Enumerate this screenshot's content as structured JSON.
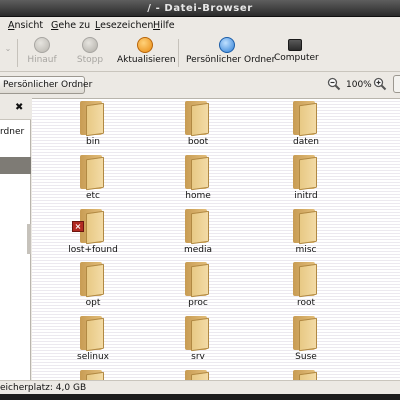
{
  "window": {
    "title": "/ - Datei-Browser"
  },
  "menubar": [
    "Ansicht",
    "Gehe zu",
    "Lesezeichen",
    "Hilfe"
  ],
  "toolbar": {
    "back_label": "",
    "up_label": "Hinauf",
    "stop_label": "Stopp",
    "reload_label": "Aktualisieren",
    "home_label": "Persönlicher Ordner",
    "computer_label": "Computer"
  },
  "location": {
    "button_label": "Persönlicher Ordner",
    "zoom": "100%"
  },
  "sidebar": {
    "close_glyph": "✖",
    "item_partial": "rdner"
  },
  "folders": [
    {
      "name": "bin"
    },
    {
      "name": "boot"
    },
    {
      "name": "daten"
    },
    {
      "name": "etc"
    },
    {
      "name": "home"
    },
    {
      "name": "initrd"
    },
    {
      "name": "lost+found",
      "restricted": true
    },
    {
      "name": "media"
    },
    {
      "name": "misc"
    },
    {
      "name": "opt"
    },
    {
      "name": "proc"
    },
    {
      "name": "root"
    },
    {
      "name": "selinux"
    },
    {
      "name": "srv"
    },
    {
      "name": "Suse"
    },
    {
      "name": ""
    },
    {
      "name": ""
    },
    {
      "name": ""
    }
  ],
  "status": {
    "text": "eicherplatz: 4,0 GB"
  },
  "colors": {
    "titlebar": "#3a3a3a",
    "folder": "#e2bd7a",
    "selection": "#7e7b75"
  }
}
